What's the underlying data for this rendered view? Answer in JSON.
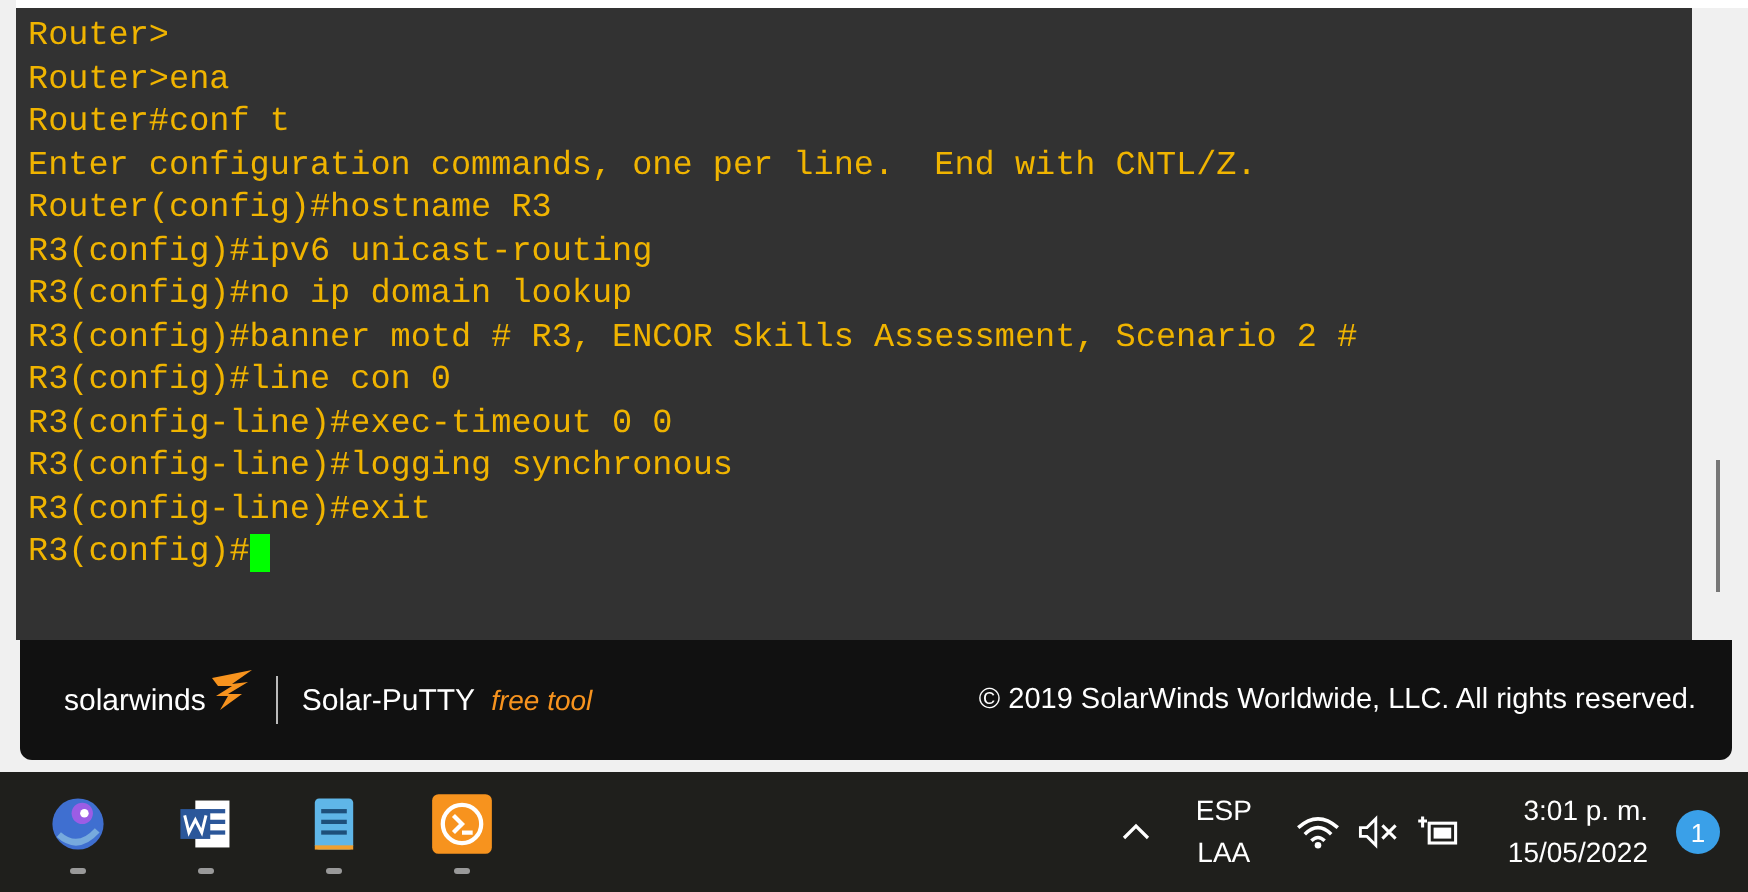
{
  "terminal": {
    "lines": [
      "Router>",
      "Router>ena",
      "Router#conf t",
      "Enter configuration commands, one per line.  End with CNTL/Z.",
      "Router(config)#hostname R3",
      "R3(config)#ipv6 unicast-routing",
      "R3(config)#no ip domain lookup",
      "R3(config)#banner motd # R3, ENCOR Skills Assessment, Scenario 2 #",
      "R3(config)#line con 0",
      "R3(config-line)#exec-timeout 0 0",
      "R3(config-line)#logging synchronous",
      "R3(config-line)#exit",
      "R3(config)#"
    ]
  },
  "footer": {
    "brand": "solarwinds",
    "product": "Solar-PuTTY",
    "tag": "free tool",
    "copyright": "© 2019 SolarWinds Worldwide, LLC. All rights reserved."
  },
  "taskbar": {
    "language": "ESP",
    "layout": "LAA",
    "time": "3:01 p. m.",
    "date": "15/05/2022",
    "notifications": "1"
  }
}
